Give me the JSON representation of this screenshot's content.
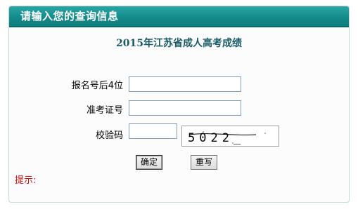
{
  "header": {
    "title": "请输入您的查询信息"
  },
  "page_title": "2015年江苏省成人高考成绩",
  "form": {
    "reg_label": "报名号后4位",
    "reg_value": "",
    "admission_label": "准考证号",
    "admission_value": "",
    "captcha_label": "校验码",
    "captcha_value": "",
    "captcha_text": "5022_"
  },
  "buttons": {
    "confirm": "确定",
    "reset": "重写"
  },
  "hint_label": "提示:",
  "colors": {
    "header_bg": "#148c8c",
    "title_text": "#1a5a66",
    "hint_text": "#d01010"
  }
}
